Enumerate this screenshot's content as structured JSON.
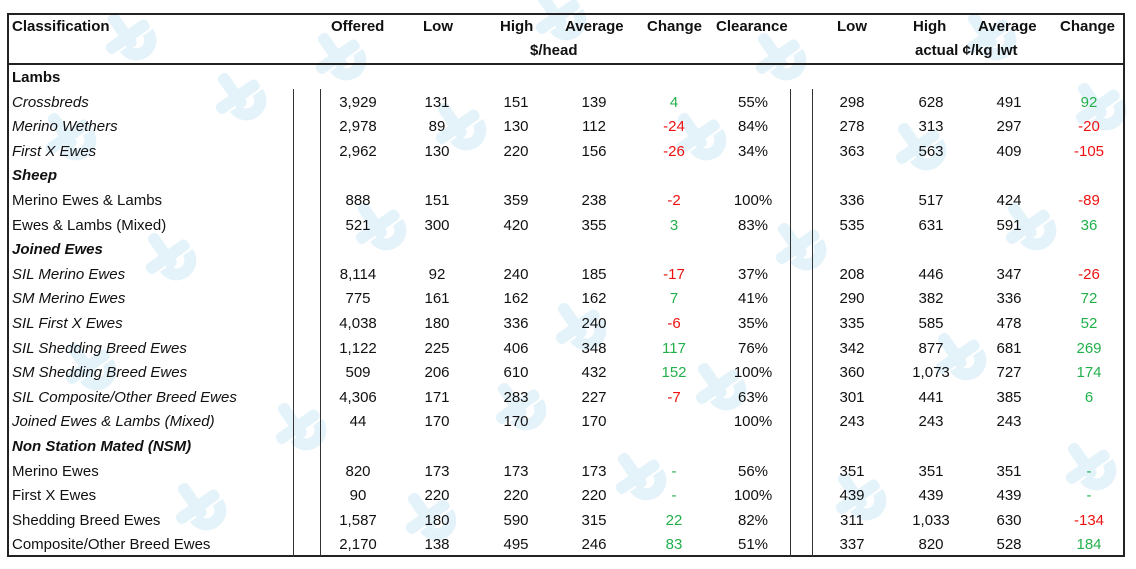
{
  "header": {
    "classification": "Classification",
    "offered": "Offered",
    "low": "Low",
    "high": "High",
    "average": "Average",
    "change": "Change",
    "clearance": "Clearance",
    "unit_head": "$/head",
    "low2": "Low",
    "high2": "High",
    "average2": "Average",
    "change2": "Change",
    "unit_kg": "actual ¢/kg lwt"
  },
  "colors": {
    "positive": "#22b04c",
    "negative": "#ee1111",
    "watermark": "#cfe9f7"
  },
  "rows": [
    {
      "type": "section",
      "label": "Lambs",
      "style": "plain"
    },
    {
      "type": "data",
      "label": "Crossbreds",
      "italic": true,
      "offered": "3,929",
      "low": "131",
      "high": "151",
      "avg": "139",
      "chg": "4",
      "chg_sign": "pos",
      "clear": "55%",
      "low2": "298",
      "high2": "628",
      "avg2": "491",
      "chg2": "92",
      "chg2_sign": "pos"
    },
    {
      "type": "data",
      "label": "Merino Wethers",
      "italic": true,
      "offered": "2,978",
      "low": "89",
      "high": "130",
      "avg": "112",
      "chg": "-24",
      "chg_sign": "neg",
      "clear": "84%",
      "low2": "278",
      "high2": "313",
      "avg2": "297",
      "chg2": "-20",
      "chg2_sign": "neg"
    },
    {
      "type": "data",
      "label": "First X Ewes",
      "italic": true,
      "offered": "2,962",
      "low": "130",
      "high": "220",
      "avg": "156",
      "chg": "-26",
      "chg_sign": "neg",
      "clear": "34%",
      "low2": "363",
      "high2": "563",
      "avg2": "409",
      "chg2": "-105",
      "chg2_sign": "neg"
    },
    {
      "type": "section",
      "label": "Sheep",
      "style": "italic"
    },
    {
      "type": "data",
      "label": "Merino Ewes & Lambs",
      "italic": false,
      "offered": "888",
      "low": "151",
      "high": "359",
      "avg": "238",
      "chg": "-2",
      "chg_sign": "neg",
      "clear": "100%",
      "low2": "336",
      "high2": "517",
      "avg2": "424",
      "chg2": "-89",
      "chg2_sign": "neg"
    },
    {
      "type": "data",
      "label": "Ewes & Lambs (Mixed)",
      "italic": false,
      "offered": "521",
      "low": "300",
      "high": "420",
      "avg": "355",
      "chg": "3",
      "chg_sign": "pos",
      "clear": "83%",
      "low2": "535",
      "high2": "631",
      "avg2": "591",
      "chg2": "36",
      "chg2_sign": "pos"
    },
    {
      "type": "section",
      "label": "Joined Ewes",
      "style": "italic"
    },
    {
      "type": "data",
      "label": "SIL Merino Ewes",
      "italic": true,
      "offered": "8,114",
      "low": "92",
      "high": "240",
      "avg": "185",
      "chg": "-17",
      "chg_sign": "neg",
      "clear": "37%",
      "low2": "208",
      "high2": "446",
      "avg2": "347",
      "chg2": "-26",
      "chg2_sign": "neg"
    },
    {
      "type": "data",
      "label": "SM Merino Ewes",
      "italic": true,
      "offered": "775",
      "low": "161",
      "high": "162",
      "avg": "162",
      "chg": "7",
      "chg_sign": "pos",
      "clear": "41%",
      "low2": "290",
      "high2": "382",
      "avg2": "336",
      "chg2": "72",
      "chg2_sign": "pos"
    },
    {
      "type": "data",
      "label": "SIL First X Ewes",
      "italic": true,
      "offered": "4,038",
      "low": "180",
      "high": "336",
      "avg": "240",
      "chg": "-6",
      "chg_sign": "neg",
      "clear": "35%",
      "low2": "335",
      "high2": "585",
      "avg2": "478",
      "chg2": "52",
      "chg2_sign": "pos"
    },
    {
      "type": "data",
      "label": "SIL Shedding Breed Ewes",
      "italic": true,
      "offered": "1,122",
      "low": "225",
      "high": "406",
      "avg": "348",
      "chg": "117",
      "chg_sign": "pos",
      "clear": "76%",
      "low2": "342",
      "high2": "877",
      "avg2": "681",
      "chg2": "269",
      "chg2_sign": "pos"
    },
    {
      "type": "data",
      "label": "SM Shedding Breed Ewes",
      "italic": true,
      "offered": "509",
      "low": "206",
      "high": "610",
      "avg": "432",
      "chg": "152",
      "chg_sign": "pos",
      "clear": "100%",
      "low2": "360",
      "high2": "1,073",
      "avg2": "727",
      "chg2": "174",
      "chg2_sign": "pos"
    },
    {
      "type": "data",
      "label": "SIL Composite/Other Breed Ewes",
      "italic": true,
      "offered": "4,306",
      "low": "171",
      "high": "283",
      "avg": "227",
      "chg": "-7",
      "chg_sign": "neg",
      "clear": "63%",
      "low2": "301",
      "high2": "441",
      "avg2": "385",
      "chg2": "6",
      "chg2_sign": "pos"
    },
    {
      "type": "data",
      "label": "Joined Ewes & Lambs (Mixed)",
      "italic": true,
      "offered": "44",
      "low": "170",
      "high": "170",
      "avg": "170",
      "chg": "",
      "chg_sign": "pos",
      "clear": "100%",
      "low2": "243",
      "high2": "243",
      "avg2": "243",
      "chg2": "",
      "chg2_sign": "pos"
    },
    {
      "type": "section",
      "label": "Non Station Mated (NSM)",
      "style": "italic"
    },
    {
      "type": "data",
      "label": "Merino Ewes",
      "italic": false,
      "offered": "820",
      "low": "173",
      "high": "173",
      "avg": "173",
      "chg": "-",
      "chg_sign": "pos",
      "clear": "56%",
      "low2": "351",
      "high2": "351",
      "avg2": "351",
      "chg2": "-",
      "chg2_sign": "pos"
    },
    {
      "type": "data",
      "label": "First X Ewes",
      "italic": false,
      "offered": "90",
      "low": "220",
      "high": "220",
      "avg": "220",
      "chg": "-",
      "chg_sign": "pos",
      "clear": "100%",
      "low2": "439",
      "high2": "439",
      "avg2": "439",
      "chg2": "-",
      "chg2_sign": "pos"
    },
    {
      "type": "data",
      "label": "Shedding Breed Ewes",
      "italic": false,
      "offered": "1,587",
      "low": "180",
      "high": "590",
      "avg": "315",
      "chg": "22",
      "chg_sign": "pos",
      "clear": "82%",
      "low2": "311",
      "high2": "1,033",
      "avg2": "630",
      "chg2": "-134",
      "chg2_sign": "neg"
    },
    {
      "type": "data",
      "label": "Composite/Other Breed Ewes",
      "italic": false,
      "offered": "2,170",
      "low": "138",
      "high": "495",
      "avg": "246",
      "chg": "83",
      "chg_sign": "pos",
      "clear": "51%",
      "low2": "337",
      "high2": "820",
      "avg2": "528",
      "chg2": "184",
      "chg2_sign": "pos"
    }
  ]
}
